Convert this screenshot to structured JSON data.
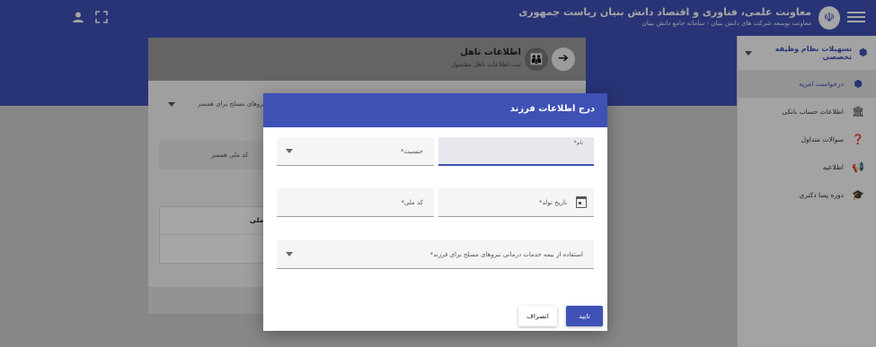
{
  "header": {
    "title": "معاونت علمی، فناوری و اقتصاد دانش بنیان ریاست جمهوری",
    "subtitle": "معاونت توسعه شرکت های دانش بنیان - سامانه جامع دانش بنیان",
    "menu_icon": "hamburger-menu-icon",
    "emblem_icon": "government-emblem-icon",
    "user_icon": "user-icon",
    "fullscreen_icon": "fullscreen-icon"
  },
  "sidebar": {
    "section": "تسهیلات نظام وظیفه تخصصی",
    "items": [
      {
        "label": "درخواست امریه",
        "icon": "exemption-icon",
        "active": true
      },
      {
        "label": "اطلاعات حساب بانکی",
        "icon": "bank-icon",
        "active": false
      },
      {
        "label": "سوالات متداول",
        "icon": "faq-icon",
        "active": false
      },
      {
        "label": "اطلاعیه",
        "icon": "announcement-icon",
        "active": false
      },
      {
        "label": "دوره پسا دکتری",
        "icon": "graduation-icon",
        "active": false
      }
    ]
  },
  "background_card": {
    "title": "اطلاعات تاهل",
    "subtitle": "ثبت اطلاعات تاهل مشمول",
    "spouse_insurance_label": "استفاده از بیمه خدمات درمانی نیروهای مسلح برای همسر",
    "spouse_national_code_label": "کد ملی همسر",
    "table_header": "کد ملی"
  },
  "dialog": {
    "title": "درج اطلاعات فرزند",
    "fields": {
      "name": "نام*",
      "gender": "جنسیت*",
      "birth_date": "تاریخ تولد*",
      "national_code": "کد ملی*",
      "insurance": "استفاده از بیمه خدمات درمانی نیروهای مسلح برای فرزند*"
    },
    "confirm_label": "تایید",
    "cancel_label": "انصراف"
  }
}
